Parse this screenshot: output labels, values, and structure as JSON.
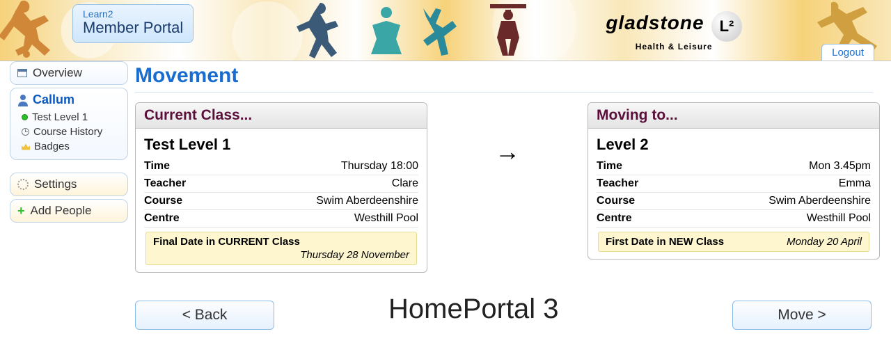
{
  "header": {
    "portal_badge_small": "Learn2",
    "portal_badge_big": "Member Portal",
    "brand_name": "gladstone",
    "brand_sub": "Health & Leisure",
    "logout": "Logout"
  },
  "sidebar": {
    "overview": "Overview",
    "member_name": "Callum",
    "items": [
      {
        "label": "Test Level 1",
        "icon": "green-dot"
      },
      {
        "label": "Course History",
        "icon": "clock"
      },
      {
        "label": "Badges",
        "icon": "crown"
      }
    ],
    "settings": "Settings",
    "add_people": "Add People"
  },
  "page": {
    "title": "Movement",
    "watermark": "HomePortal 3",
    "back_btn": "< Back",
    "move_btn": "Move >"
  },
  "current": {
    "header": "Current Class...",
    "title": "Test Level 1",
    "rows": {
      "time_k": "Time",
      "time_v": "Thursday 18:00",
      "teacher_k": "Teacher",
      "teacher_v": "Clare",
      "course_k": "Course",
      "course_v": "Swim Aberdeenshire",
      "centre_k": "Centre",
      "centre_v": "Westhill Pool"
    },
    "note_title": "Final Date in CURRENT Class",
    "note_date": "Thursday 28 November"
  },
  "moving": {
    "header": "Moving to...",
    "title": "Level 2",
    "rows": {
      "time_k": "Time",
      "time_v": "Mon 3.45pm",
      "teacher_k": "Teacher",
      "teacher_v": "Emma",
      "course_k": "Course",
      "course_v": "Swim Aberdeenshire",
      "centre_k": "Centre",
      "centre_v": "Westhill Pool"
    },
    "note_title": "First Date in NEW Class",
    "note_date": "Monday 20 April"
  }
}
